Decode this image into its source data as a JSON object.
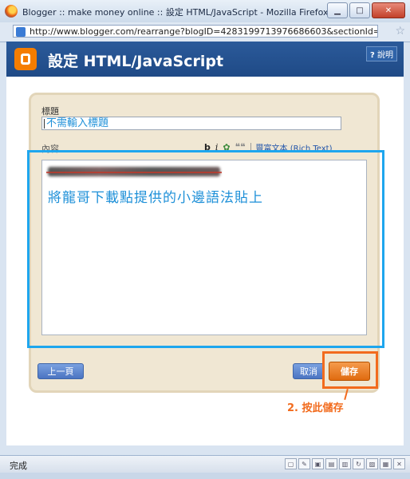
{
  "window": {
    "title": "Blogger :: make money online :: 設定 HTML/JavaScript - Mozilla Firefox",
    "minimize": "▁",
    "maximize": "□",
    "close": "✕"
  },
  "urlbar": {
    "url": "http://www.blogger.com/rearrange?blogID=4283199713976686603&sectionId=sidebar&"
  },
  "header": {
    "title": "設定 HTML/JavaScript",
    "help_icon": "?",
    "help_label": "說明"
  },
  "form": {
    "title_label": "標題",
    "title_value": "不需輸入標題",
    "content_label": "內容",
    "toolbar": {
      "bold": "b",
      "italic": "i",
      "link": "✿",
      "quote": "❝❝",
      "rich_text": "豐富文本 (Rich Text)"
    },
    "content_text": "將龍哥下載點提供的小邊語法貼上"
  },
  "buttons": {
    "prev": "上一頁",
    "cancel": "取消",
    "save": "儲存"
  },
  "annotation": "2. 按此儲存",
  "statusbar": {
    "text": "完成"
  },
  "colors": {
    "accent_blue": "#1ea6ee",
    "annotation_orange": "#f26b1d",
    "header_blue": "#2b5a9a",
    "blogger_orange": "#f57d00"
  }
}
